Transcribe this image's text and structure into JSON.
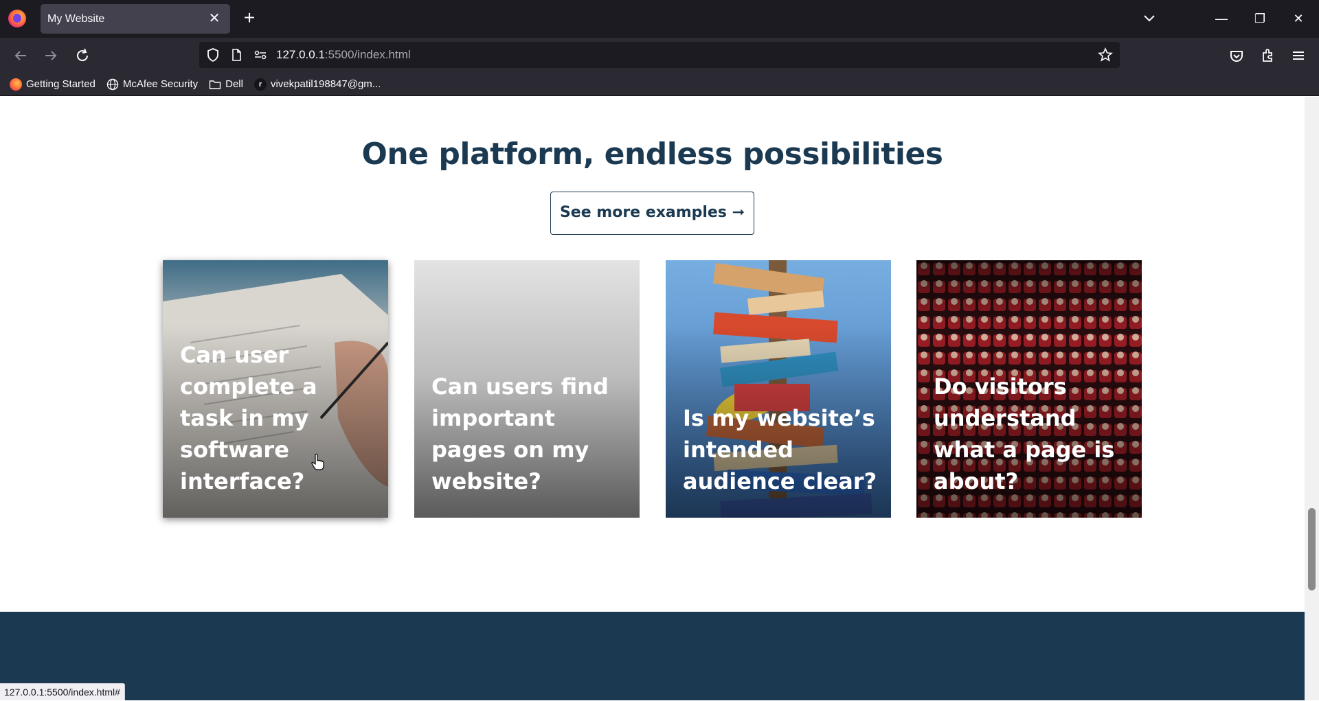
{
  "browser": {
    "tab_title": "My Website",
    "tab_close": "✕",
    "new_tab": "+",
    "url_host": "127.0.0.1",
    "url_rest": ":5500/index.html",
    "bookmarks": [
      {
        "label": "Getting Started",
        "icon": "firefox-icon"
      },
      {
        "label": "McAfee Security",
        "icon": "globe-icon"
      },
      {
        "label": "Dell",
        "icon": "folder-icon"
      },
      {
        "label": "vivekpatil198847@gm...",
        "icon": "site-icon"
      }
    ],
    "window_controls": {
      "minimize": "—",
      "restore": "❐",
      "close": "✕"
    },
    "status_url": "127.0.0.1:5500/index.html#"
  },
  "page": {
    "headline": "One platform, endless possibilities",
    "cta_label": "See more examples ➞",
    "cards": [
      {
        "title": "Can user complete a task in my software interface?"
      },
      {
        "title": "Can users find important pages on my website?"
      },
      {
        "title": "Is my website’s intended audience clear?"
      },
      {
        "title": "Do visitors understand what a page is about?"
      }
    ]
  }
}
